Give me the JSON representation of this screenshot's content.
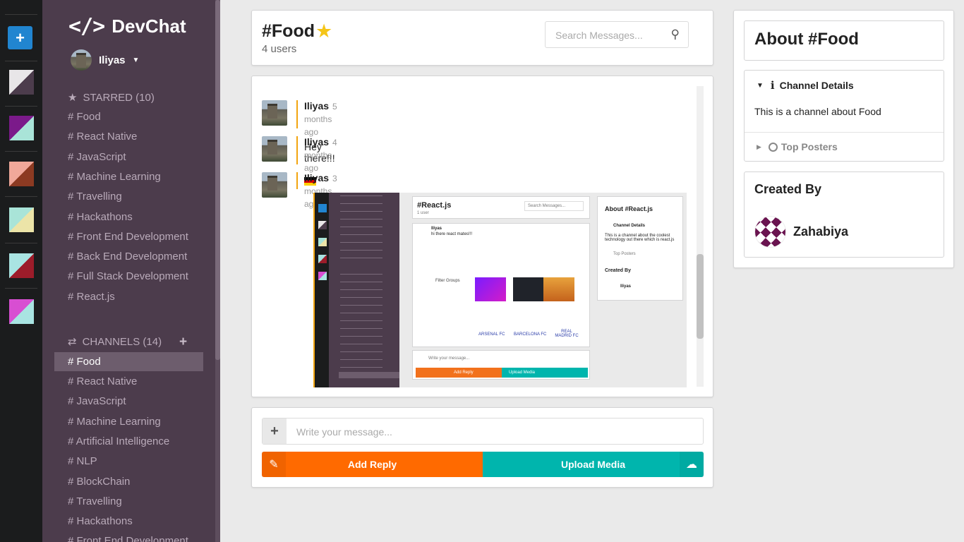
{
  "app": {
    "name": "DevChat",
    "logo_glyph": "</>"
  },
  "user": {
    "name": "Iliyas"
  },
  "color_strip": {
    "add_label": "+",
    "swatches": [
      {
        "a": "#e8e6e8",
        "b": "#4c3c4c"
      },
      {
        "a": "#7b1a8a",
        "b": "#a9e4d8"
      },
      {
        "a": "#f0a89a",
        "b": "#8c3a22"
      },
      {
        "a": "#a9e4d8",
        "b": "#ece4a8"
      },
      {
        "a": "#a9e4e2",
        "b": "#9c1c2a"
      },
      {
        "a": "#d84ed2",
        "b": "#a9e4e2"
      }
    ]
  },
  "starred": {
    "title": "STARRED (10)",
    "items": [
      "# Food",
      "# React Native",
      "# JavaScript",
      "# Machine Learning",
      "# Travelling",
      "# Hackathons",
      "# Front End Development",
      "# Back End Development",
      "# Full Stack Development",
      "# React.js"
    ]
  },
  "channels": {
    "title": "CHANNELS (14)",
    "items": [
      "# Food",
      "# React Native",
      "# JavaScript",
      "# Machine Learning",
      "# Artificial Intelligence",
      "# NLP",
      "# BlockChain",
      "# Travelling",
      "# Hackathons",
      "# Front End Development"
    ],
    "active_index": 0
  },
  "channel_header": {
    "title": "#Food",
    "users": "4 users",
    "search_placeholder": "Search Messages..."
  },
  "messages": [
    {
      "author": "Iliyas",
      "time": "5 months ago",
      "text": "Hey there!!!"
    },
    {
      "author": "Iliyas",
      "time": "4 months ago",
      "text": ""
    },
    {
      "author": "Iliyas",
      "time": "3 months ago",
      "text": ""
    }
  ],
  "preview": {
    "title": "#React.js",
    "users": "1 user",
    "search": "Search Messages...",
    "about": "About #React.js",
    "details": "Channel Details",
    "desc": "This is a channel about the coolest technology out there which is react.js",
    "top": "Top Posters",
    "created": "Created By",
    "creator": "Iliyas",
    "msg1": "hi there react mates!!!",
    "author": "Iliyas",
    "composer": "Write your message...",
    "reply": "Add Reply",
    "upload": "Upload Media",
    "cards": [
      "ARSENAL FC",
      "BARCELONA FC",
      "REAL MADRID FC"
    ],
    "filter": "Filter Groups"
  },
  "composer": {
    "placeholder": "Write your message...",
    "add_reply": "Add Reply",
    "upload_media": "Upload Media"
  },
  "meta": {
    "about_title": "About #Food",
    "details_title": "Channel Details",
    "details_text": "This is a channel about Food",
    "top_posters": "Top Posters",
    "created_by": "Created By",
    "creator": "Zahabiya"
  },
  "colors": {
    "sidebar": "#4c3c4c",
    "reply": "#ff6a00",
    "upload": "#00b5ad",
    "accent_bar": "#f2a40f",
    "add_button": "#2185d0"
  },
  "icons": {
    "star": "star-icon",
    "exchange": "exchange-icon",
    "search": "search-icon",
    "edit": "edit-icon",
    "cloud_upload": "cloud-upload-icon",
    "info": "info-icon",
    "user": "user-circle-icon"
  }
}
